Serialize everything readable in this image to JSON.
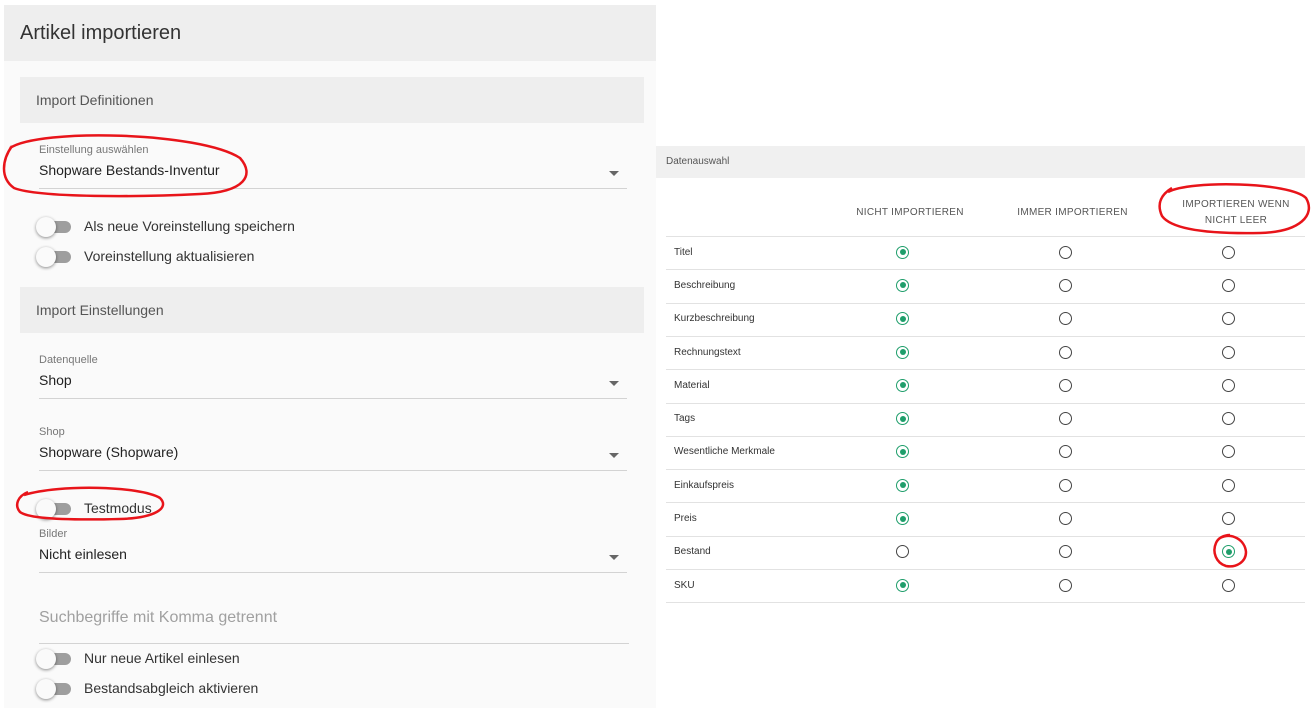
{
  "page_title": "Artikel importieren",
  "sections": {
    "definitions_title": "Import Definitionen",
    "settings_title": "Import Einstellungen"
  },
  "preset": {
    "label": "Einstellung auswählen",
    "value": "Shopware Bestands-Inventur"
  },
  "toggles": {
    "save_new": "Als neue Voreinstellung speichern",
    "update": "Voreinstellung aktualisieren",
    "testmode": "Testmodus",
    "only_new": "Nur neue Artikel einlesen",
    "stock_sync": "Bestandsabgleich aktivieren"
  },
  "datasource": {
    "label": "Datenquelle",
    "value": "Shop"
  },
  "shop": {
    "label": "Shop",
    "value": "Shopware (Shopware)"
  },
  "images": {
    "label": "Bilder",
    "value": "Nicht einlesen"
  },
  "search": {
    "placeholder": "Suchbegriffe mit Komma getrennt"
  },
  "data_selection": {
    "title": "Datenauswahl",
    "columns": [
      "NICHT IMPORTIEREN",
      "IMMER IMPORTIEREN",
      "IMPORTIEREN WENN NICHT LEER"
    ],
    "rows": [
      {
        "label": "Titel",
        "selected": 0
      },
      {
        "label": "Beschreibung",
        "selected": 0
      },
      {
        "label": "Kurzbeschreibung",
        "selected": 0
      },
      {
        "label": "Rechnungstext",
        "selected": 0
      },
      {
        "label": "Material",
        "selected": 0
      },
      {
        "label": "Tags",
        "selected": 0
      },
      {
        "label": "Wesentliche Merkmale",
        "selected": 0
      },
      {
        "label": "Einkaufspreis",
        "selected": 0
      },
      {
        "label": "Preis",
        "selected": 0
      },
      {
        "label": "Bestand",
        "selected": 2
      },
      {
        "label": "SKU",
        "selected": 0
      }
    ]
  },
  "colors": {
    "accent_green": "#1f9e6b",
    "annotation_red": "#e8141a",
    "header_gray": "#eeeeee"
  }
}
